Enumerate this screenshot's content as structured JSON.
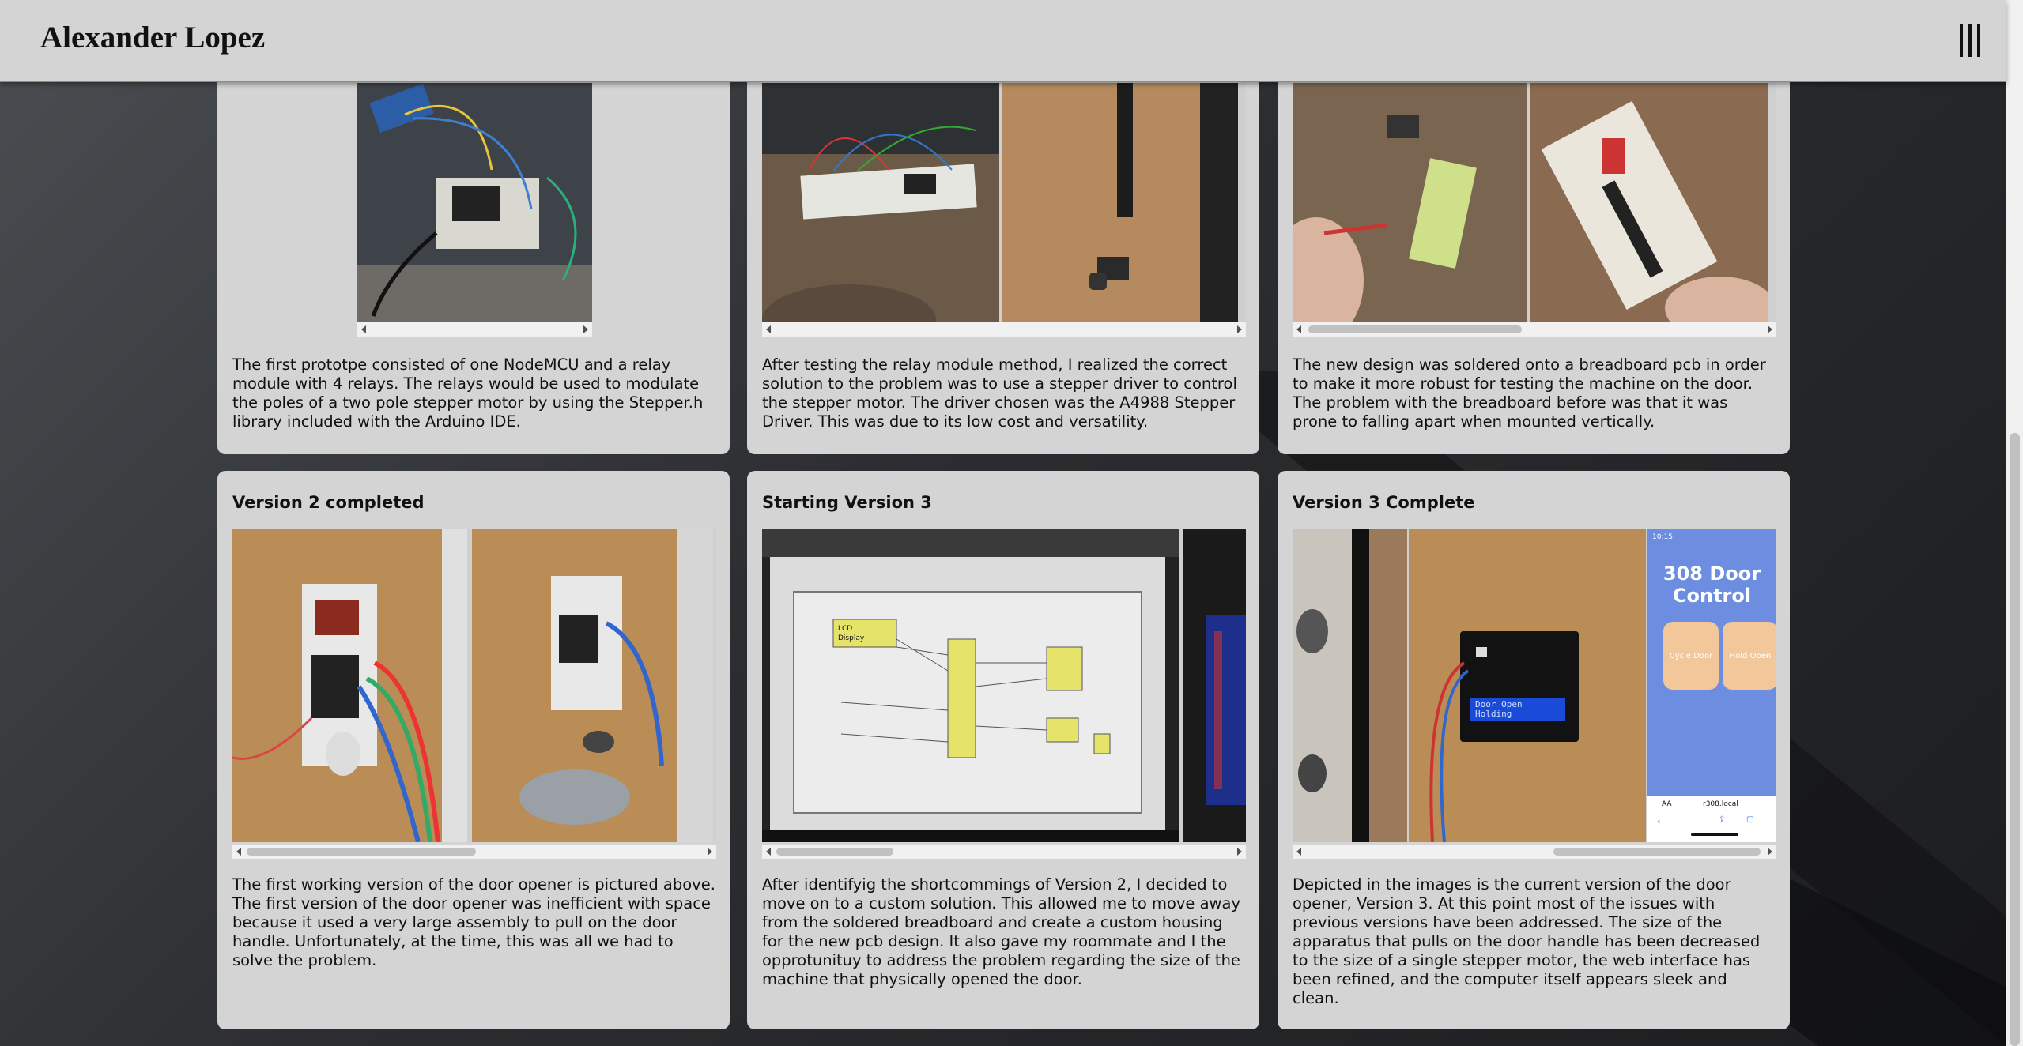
{
  "header": {
    "title": "Alexander Lopez",
    "menu_icon": "hamburger-menu-icon"
  },
  "cards": [
    {
      "title": "",
      "text": "The first prototpe consisted of one NodeMCU and a relay module with 4 relays. The relays would be used to modulate the poles of a two pole stepper motor by using the Stepper.h library included with the Arduino IDE."
    },
    {
      "title": "",
      "text": "After testing the relay module method, I realized the correct solution to the problem was to use a stepper driver to control the stepper motor. The driver chosen was the A4988 Stepper Driver. This was due to its low cost and versatility."
    },
    {
      "title": "",
      "text": "The new design was soldered onto a breadboard pcb in order to make it more robust for testing the machine on the door. The problem with the breadboard before was that it was prone to falling apart when mounted vertically."
    },
    {
      "title": "Version 2 completed",
      "text": "The first working version of the door opener is pictured above. The first version of the door opener was inefficient with space because it used a very large assembly to pull on the door handle. Unfortunately, at the time, this was all we had to solve the problem."
    },
    {
      "title": "Starting Version 3",
      "text": "After identifyig the shortcommings of Version 2, I decided to move on to a custom solution. This allowed me to move away from the soldered breadboard and create a custom housing for the new pcb design. It also gave my roommate and I the opprotunituy to address the problem regarding the size of the machine that physically opened the door."
    },
    {
      "title": "Version 3 Complete",
      "text": "Depicted in the images is the current version of the door opener, Version 3. At this point most of the issues with previous versions have been addressed. The size of the apparatus that pulls on the door handle has been decreased to the size of a single stepper motor, the web interface has been refined, and the computer itself appears sleek and clean."
    }
  ],
  "photo_text": {
    "lcd_label": "LCD\nDisplay",
    "lcd_screen": "Door Open\nHolding",
    "phone_time": "10:15",
    "phone_title": "308 Door Control",
    "phone_button_1": "Cycle Door",
    "phone_button_2": "Hold Open",
    "phone_url": "r308.local",
    "phone_aa": "AA"
  },
  "colors": {
    "header_bg": "#d4d4d4",
    "card_bg": "#d4d4d4",
    "page_bg": "#2b2d30",
    "phone_bg": "#6d8ee0"
  }
}
